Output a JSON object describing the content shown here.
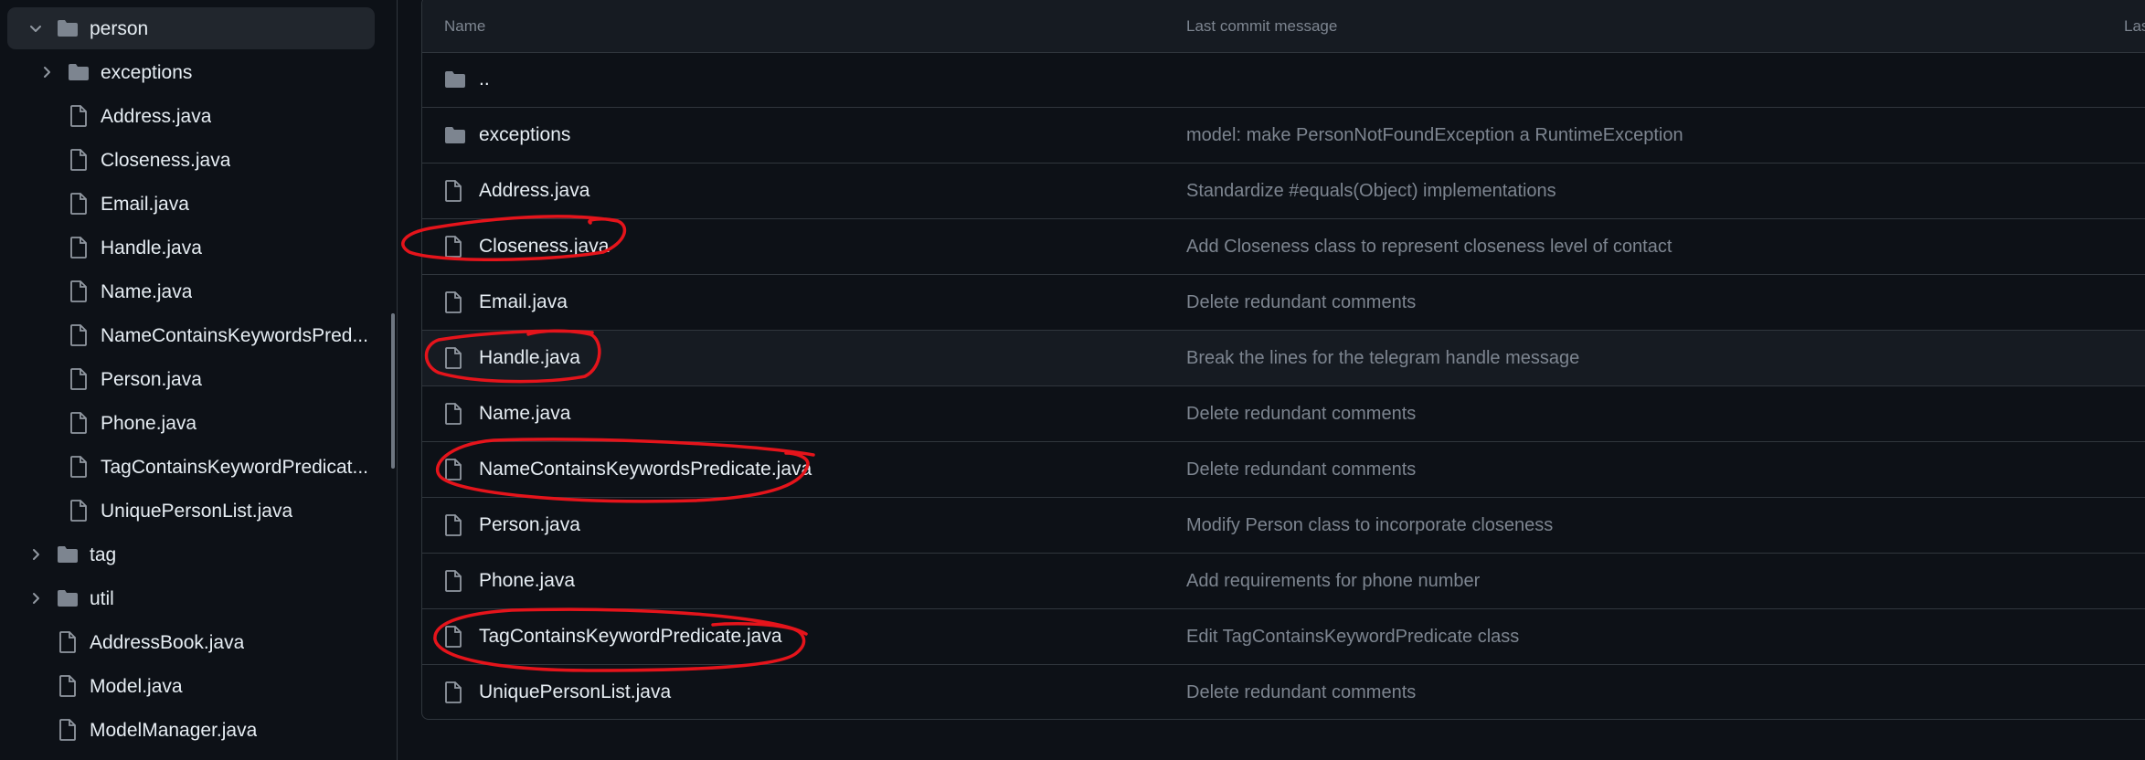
{
  "sidebar": {
    "items": [
      {
        "label": "person",
        "type": "folder",
        "expanded": true
      },
      {
        "label": "exceptions",
        "type": "folder",
        "expanded": false
      },
      {
        "label": "Address.java",
        "type": "file"
      },
      {
        "label": "Closeness.java",
        "type": "file"
      },
      {
        "label": "Email.java",
        "type": "file"
      },
      {
        "label": "Handle.java",
        "type": "file"
      },
      {
        "label": "Name.java",
        "type": "file"
      },
      {
        "label": "NameContainsKeywordsPred...",
        "type": "file"
      },
      {
        "label": "Person.java",
        "type": "file"
      },
      {
        "label": "Phone.java",
        "type": "file"
      },
      {
        "label": "TagContainsKeywordPredicat...",
        "type": "file"
      },
      {
        "label": "UniquePersonList.java",
        "type": "file"
      },
      {
        "label": "tag",
        "type": "folder",
        "expanded": false
      },
      {
        "label": "util",
        "type": "folder",
        "expanded": false
      },
      {
        "label": "AddressBook.java",
        "type": "file"
      },
      {
        "label": "Model.java",
        "type": "file"
      },
      {
        "label": "ModelManager.java",
        "type": "file"
      }
    ]
  },
  "table": {
    "headers": {
      "name": "Name",
      "message": "Last commit message",
      "date": "Las"
    },
    "rows": [
      {
        "name": "..",
        "type": "folder",
        "message": ""
      },
      {
        "name": "exceptions",
        "type": "folder",
        "message": "model: make PersonNotFoundException a RuntimeException"
      },
      {
        "name": "Address.java",
        "type": "file",
        "message": "Standardize #equals(Object) implementations"
      },
      {
        "name": "Closeness.java",
        "type": "file",
        "message": "Add Closeness class to represent closeness level of contact"
      },
      {
        "name": "Email.java",
        "type": "file",
        "message": "Delete redundant comments"
      },
      {
        "name": "Handle.java",
        "type": "file",
        "message": "Break the lines for the telegram handle message"
      },
      {
        "name": "Name.java",
        "type": "file",
        "message": "Delete redundant comments"
      },
      {
        "name": "NameContainsKeywordsPredicate.java",
        "type": "file",
        "message": "Delete redundant comments"
      },
      {
        "name": "Person.java",
        "type": "file",
        "message": "Modify Person class to incorporate closeness"
      },
      {
        "name": "Phone.java",
        "type": "file",
        "message": "Add requirements for phone number"
      },
      {
        "name": "TagContainsKeywordPredicate.java",
        "type": "file",
        "message": "Edit TagContainsKeywordPredicate class"
      },
      {
        "name": "UniquePersonList.java",
        "type": "file",
        "message": "Delete redundant comments"
      }
    ]
  },
  "icons": {
    "folder": "folder-icon",
    "file": "file-icon",
    "chevron_right": "chevron-right-icon",
    "chevron_down": "chevron-down-icon"
  },
  "colors": {
    "background": "#0d1117",
    "header": "#161b22",
    "border": "#30363d",
    "muted_text": "#7d8590",
    "icon": "#7d8590",
    "annotation": "#e5141b"
  }
}
